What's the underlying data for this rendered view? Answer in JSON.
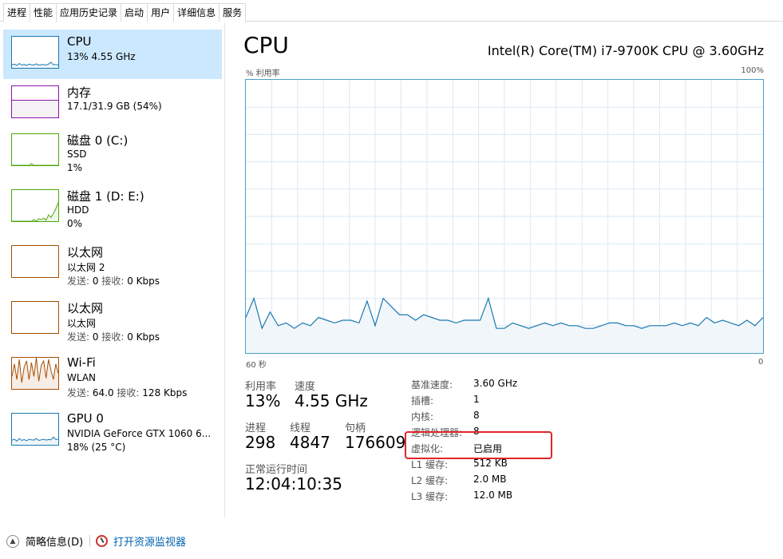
{
  "tabs": [
    "进程",
    "性能",
    "应用历史记录",
    "启动",
    "用户",
    "详细信息",
    "服务"
  ],
  "active_tab": 1,
  "sidebar": {
    "items": [
      {
        "title": "CPU",
        "line2": "13% 4.55 GHz",
        "line3": "",
        "color": "#1a7ab0",
        "selected": true
      },
      {
        "title": "内存",
        "line2": "17.1/31.9 GB (54%)",
        "line3": "",
        "color": "#8b12ae",
        "selected": false
      },
      {
        "title": "磁盘 0 (C:)",
        "line2": "SSD",
        "line3": "1%",
        "color": "#4da60c",
        "selected": false
      },
      {
        "title": "磁盘 1 (D: E:)",
        "line2": "HDD",
        "line3": "0%",
        "color": "#4da60c",
        "selected": false
      },
      {
        "title": "以太网",
        "line2": "以太网 2",
        "line3_send_label": "发送:",
        "line3_send": "0",
        "line3_recv_label": "接收:",
        "line3_recv": "0 Kbps",
        "color": "#a74f01",
        "selected": false
      },
      {
        "title": "以太网",
        "line2": "以太网",
        "line3_send_label": "发送:",
        "line3_send": "0",
        "line3_recv_label": "接收:",
        "line3_recv": "0 Kbps",
        "color": "#a74f01",
        "selected": false
      },
      {
        "title": "Wi-Fi",
        "line2": "WLAN",
        "line3_send_label": "发送:",
        "line3_send": "64.0",
        "line3_recv_label": "接收:",
        "line3_recv": "128 Kbps",
        "color": "#a74f01",
        "selected": false
      },
      {
        "title": "GPU 0",
        "line2": "NVIDIA GeForce GTX 1060 6...",
        "line3": "18% (25 °C)",
        "color": "#1a7ab0",
        "selected": false
      }
    ]
  },
  "main": {
    "title": "CPU",
    "model": "Intel(R) Core(TM) i7-9700K CPU @ 3.60GHz",
    "graph": {
      "y_label": "% 利用率",
      "y_max": "100%",
      "x_left": "60 秒",
      "x_right": "0",
      "line_color": "#1a7ab0",
      "fill_color": "#f1f6fa",
      "grid_color": "#d9eaf4",
      "values": [
        13,
        20,
        9,
        15,
        10,
        11,
        9,
        11,
        10,
        13,
        12,
        11,
        12,
        12,
        11,
        19,
        10,
        20,
        17,
        14,
        14,
        12,
        14,
        13,
        12,
        12,
        11,
        12,
        12,
        12,
        20,
        9,
        9,
        11,
        10,
        9,
        10,
        11,
        10,
        11,
        10,
        10,
        9,
        9,
        10,
        11,
        11,
        10,
        10,
        9,
        10,
        10,
        10,
        11,
        10,
        11,
        10,
        13,
        11,
        12,
        11,
        10,
        12,
        10,
        13
      ]
    },
    "stats": {
      "utilization_label": "利用率",
      "utilization": "13%",
      "speed_label": "速度",
      "speed": "4.55 GHz",
      "processes_label": "进程",
      "processes": "298",
      "threads_label": "线程",
      "threads": "4847",
      "handles_label": "句柄",
      "handles": "176609",
      "uptime_label": "正常运行时间",
      "uptime": "12:04:10:35"
    },
    "details": [
      {
        "k": "基准速度:",
        "v": "3.60 GHz"
      },
      {
        "k": "插槽:",
        "v": "1"
      },
      {
        "k": "内核:",
        "v": "8"
      },
      {
        "k": "逻辑处理器:",
        "v": "8"
      },
      {
        "k": "虚拟化:",
        "v": "已启用"
      },
      {
        "k": "L1 缓存:",
        "v": "512 KB"
      },
      {
        "k": "L2 缓存:",
        "v": "2.0 MB"
      },
      {
        "k": "L3 缓存:",
        "v": "12.0 MB"
      }
    ],
    "highlight_color": "#e0262b"
  },
  "bottom": {
    "fewer_details": "简略信息(D)",
    "open_monitor": "打开资源监视器"
  },
  "thumbs": {
    "cpu": [
      10,
      12,
      8,
      14,
      9,
      11,
      8,
      12,
      10,
      9,
      13,
      9,
      10,
      11,
      9,
      12,
      18,
      10,
      11,
      9
    ],
    "disk0": [
      0,
      0,
      0,
      0,
      0,
      0,
      0,
      0,
      5,
      0,
      0,
      0,
      0,
      0,
      0,
      0,
      0,
      0,
      0,
      0
    ],
    "disk1": [
      0,
      0,
      0,
      0,
      0,
      0,
      0,
      0,
      0,
      5,
      0,
      8,
      5,
      10,
      3,
      20,
      12,
      25,
      40,
      60
    ],
    "wifi": [
      40,
      80,
      30,
      95,
      20,
      70,
      90,
      30,
      85,
      40,
      100,
      25,
      75,
      90,
      35,
      95,
      60,
      30,
      80,
      50
    ],
    "gpu": [
      15,
      18,
      12,
      20,
      14,
      17,
      13,
      18,
      16,
      15,
      20,
      14,
      16,
      18,
      15,
      17,
      16,
      25,
      17,
      18
    ]
  }
}
